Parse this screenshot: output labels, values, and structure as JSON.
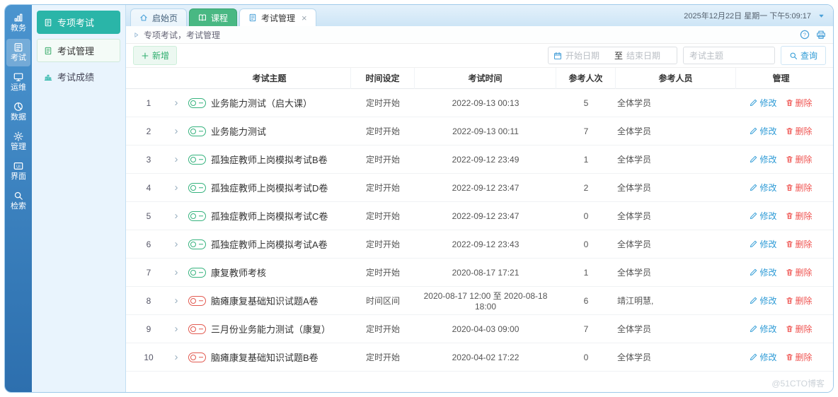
{
  "window": {
    "clock": "2025年12月22日 星期一 下午5:09:17",
    "watermark": "@51CTO博客"
  },
  "left_rail": {
    "items": [
      {
        "id": "dashboard",
        "label": "教务"
      },
      {
        "id": "exam",
        "label": "考试",
        "active": true
      },
      {
        "id": "ops",
        "label": "运维"
      },
      {
        "id": "data",
        "label": "数据"
      },
      {
        "id": "settings",
        "label": "管理"
      },
      {
        "id": "ui",
        "label": "界面"
      },
      {
        "id": "search",
        "label": "检索"
      }
    ]
  },
  "sidebar": {
    "title": "专项考试",
    "items": [
      {
        "id": "exam-manage",
        "label": "考试管理",
        "icon": "examtab",
        "active": true
      },
      {
        "id": "exam-score",
        "label": "考试成绩",
        "icon": "score"
      }
    ]
  },
  "tabs": [
    {
      "id": "home",
      "label": "启始页",
      "icon": "home"
    },
    {
      "id": "course",
      "label": "课程",
      "icon": "course",
      "kind": "green"
    },
    {
      "id": "exam-manage",
      "label": "考试管理",
      "icon": "examtab",
      "active": true,
      "closable": true
    }
  ],
  "breadcrumb": {
    "text": "专项考试，考试管理"
  },
  "toolbar": {
    "add_label": "新增",
    "start_placeholder": "开始日期",
    "to_label": "至",
    "end_placeholder": "结束日期",
    "subject_placeholder": "考试主题",
    "search_label": "查询"
  },
  "table": {
    "headers": [
      "考试主题",
      "时间设定",
      "考试时间",
      "参考人次",
      "参考人员",
      "管理"
    ],
    "edit_label": "修改",
    "delete_label": "删除",
    "rows": [
      {
        "index": "1",
        "status": "on",
        "subject": "业务能力测试（启大课）",
        "mode": "定时开始",
        "time": "2022-09-13 00:13",
        "count": "5",
        "people": "全体学员"
      },
      {
        "index": "2",
        "status": "on",
        "subject": "业务能力测试",
        "mode": "定时开始",
        "time": "2022-09-13 00:11",
        "count": "7",
        "people": "全体学员"
      },
      {
        "index": "3",
        "status": "on",
        "subject": "孤独症教师上岗模拟考试B卷",
        "mode": "定时开始",
        "time": "2022-09-12 23:49",
        "count": "1",
        "people": "全体学员"
      },
      {
        "index": "4",
        "status": "on",
        "subject": "孤独症教师上岗模拟考试D卷",
        "mode": "定时开始",
        "time": "2022-09-12 23:47",
        "count": "2",
        "people": "全体学员"
      },
      {
        "index": "5",
        "status": "on",
        "subject": "孤独症教师上岗模拟考试C卷",
        "mode": "定时开始",
        "time": "2022-09-12 23:47",
        "count": "0",
        "people": "全体学员"
      },
      {
        "index": "6",
        "status": "on",
        "subject": "孤独症教师上岗模拟考试A卷",
        "mode": "定时开始",
        "time": "2022-09-12 23:43",
        "count": "0",
        "people": "全体学员"
      },
      {
        "index": "7",
        "status": "on",
        "subject": "康复教师考核",
        "mode": "定时开始",
        "time": "2020-08-17 17:21",
        "count": "1",
        "people": "全体学员"
      },
      {
        "index": "8",
        "status": "off",
        "subject": "脑瘫康复基础知识试题A卷",
        "mode": "时间区间",
        "time": "2020-08-17 12:00 至 2020-08-18 18:00",
        "count": "6",
        "people": "靖江明慧,"
      },
      {
        "index": "9",
        "status": "off",
        "subject": "三月份业务能力测试（康复）",
        "mode": "定时开始",
        "time": "2020-04-03 09:00",
        "count": "7",
        "people": "全体学员"
      },
      {
        "index": "10",
        "status": "off",
        "subject": "脑瘫康复基础知识试题B卷",
        "mode": "定时开始",
        "time": "2020-04-02 17:22",
        "count": "0",
        "people": "全体学员"
      }
    ]
  },
  "colors": {
    "accent_blue": "#2e9bd6",
    "teal": "#2ab5a8",
    "green": "#36b37e",
    "red": "#e25a50"
  }
}
